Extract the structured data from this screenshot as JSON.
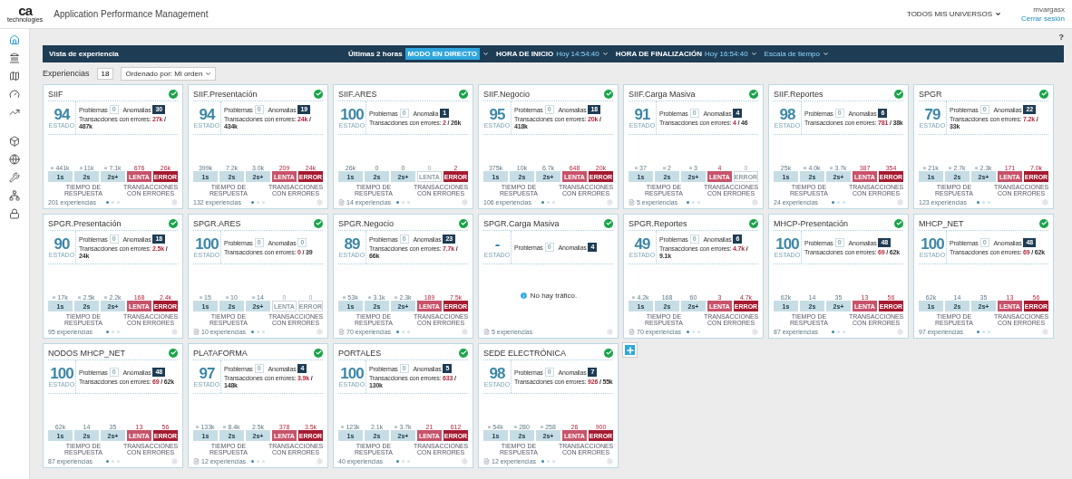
{
  "header": {
    "logo": {
      "mark": "ca",
      "sub": "technologies"
    },
    "title": "Application Performance Management",
    "universe": "TODOS MIS UNIVERSOS",
    "user": "mvargasx",
    "logout": "Cerrar sesión"
  },
  "sidebar": {
    "items": [
      {
        "selected": true
      },
      {
        "selected": false
      },
      {
        "selected": false
      },
      {
        "selected": false
      },
      {
        "selected": false
      },
      {
        "selected": false
      },
      {
        "selected": false
      },
      {
        "selected": false
      },
      {
        "selected": false
      },
      {
        "selected": false
      }
    ]
  },
  "help": "?",
  "toolbar": {
    "title": "Vista de experiencia",
    "range": "Últimas 2 horas",
    "live": "MODO EN DIRECTO",
    "start_label": "HORA DE INICIO",
    "start": "Hoy 14:54:40",
    "end_label": "HORA DE FINALIZACIÓN",
    "end": "Hoy 16:54:40",
    "scale": "Escala de tiempo"
  },
  "summary": {
    "label": "Experiencias",
    "count": "18",
    "sort": "Ordenado por: Mi orden"
  },
  "cards": [
    {
      "title": "SIIF",
      "score": "94",
      "score_label": "ESTADO",
      "problems_label": "Problemas",
      "problems": "0",
      "anomalies_label": "Anomalias",
      "anomalies": "30",
      "anomalies_alert": true,
      "errors_label": "Transacciones con errores:",
      "errors": "27k",
      "total": "/ 487k",
      "bars": [
        {
          "kind": "time",
          "label": "1s",
          "value": "441k",
          "trend": true,
          "muted": false
        },
        {
          "kind": "time",
          "label": "2s",
          "value": "11k",
          "trend": true,
          "muted": false
        },
        {
          "kind": "time",
          "label": "2s+",
          "value": "7.1k",
          "trend": true,
          "muted": false
        },
        {
          "kind": "slow",
          "label": "LENTA",
          "value": "676",
          "trend": false,
          "muted": false
        },
        {
          "kind": "error",
          "label": "ERROR",
          "value": "26k",
          "trend": false,
          "muted": false
        }
      ],
      "axis_left": "TIEMPO DE RESPUESTA",
      "axis_right": "TRANSACCIONES CON ERRORES",
      "footer": "201 experiencias",
      "doc": false,
      "dots": [
        {
          "selected": true
        },
        {
          "selected": false
        },
        {
          "selected": false
        }
      ]
    },
    {
      "title": "SIIF.Presentación",
      "score": "94",
      "score_label": "ESTADO",
      "problems_label": "Problemas",
      "problems": "0",
      "anomalies_label": "Anomalias",
      "anomalies": "19",
      "anomalies_alert": true,
      "errors_label": "Transacciones con errores:",
      "errors": "24k",
      "total": "/ 434k",
      "bars": [
        {
          "kind": "time",
          "label": "1s",
          "value": "399k",
          "trend": false,
          "muted": false
        },
        {
          "kind": "time",
          "label": "2s",
          "value": "7.2k",
          "trend": false,
          "muted": false
        },
        {
          "kind": "time",
          "label": "2s+",
          "value": "3.0k",
          "trend": false,
          "muted": false
        },
        {
          "kind": "slow",
          "label": "LENTA",
          "value": "209",
          "trend": false,
          "muted": false
        },
        {
          "kind": "error",
          "label": "ERROR",
          "value": "24k",
          "trend": false,
          "muted": false
        }
      ],
      "axis_left": "TIEMPO DE RESPUESTA",
      "axis_right": "TRANSACCIONES CON ERRORES",
      "footer": "132 experiencias",
      "doc": false,
      "dots": [
        {
          "selected": true
        },
        {
          "selected": false
        },
        {
          "selected": false
        }
      ]
    },
    {
      "title": "SIIF.ARES",
      "score": "100",
      "score_label": "ESTADO",
      "problems_label": "Problemas",
      "problems": "0",
      "anomalies_label": "Anomalia",
      "anomalies": "1",
      "anomalies_alert": true,
      "errors_label": "Transacciones con errores:",
      "errors": "2",
      "total": "/ 26k",
      "bars": [
        {
          "kind": "time",
          "label": "1s",
          "value": "26k",
          "trend": false,
          "muted": false
        },
        {
          "kind": "time",
          "label": "2s",
          "value": "0",
          "trend": false,
          "muted": false
        },
        {
          "kind": "time",
          "label": "2s+",
          "value": "0",
          "trend": false,
          "muted": false
        },
        {
          "kind": "slow",
          "label": "LENTA",
          "value": "0",
          "trend": false,
          "muted": true
        },
        {
          "kind": "error",
          "label": "ERROR",
          "value": "2",
          "trend": false,
          "muted": false
        }
      ],
      "axis_left": "TIEMPO DE RESPUESTA",
      "axis_right": "TRANSACCIONES CON ERRORES",
      "footer": "14 experiencias",
      "doc": true,
      "dots": [
        {
          "selected": true
        },
        {
          "selected": false
        },
        {
          "selected": false
        }
      ]
    },
    {
      "title": "SIIF.Negocio",
      "score": "95",
      "score_label": "ESTADO",
      "problems_label": "Problemas",
      "problems": "0",
      "anomalies_label": "Anomalias",
      "anomalies": "18",
      "anomalies_alert": true,
      "errors_label": "Transacciones con errores:",
      "errors": "20k",
      "total": "/ 418k",
      "bars": [
        {
          "kind": "time",
          "label": "1s",
          "value": "375k",
          "trend": false,
          "muted": false
        },
        {
          "kind": "time",
          "label": "2s",
          "value": "10k",
          "trend": false,
          "muted": false
        },
        {
          "kind": "time",
          "label": "2s+",
          "value": "6.7k",
          "trend": false,
          "muted": false
        },
        {
          "kind": "slow",
          "label": "LENTA",
          "value": "648",
          "trend": false,
          "muted": false
        },
        {
          "kind": "error",
          "label": "ERROR",
          "value": "20k",
          "trend": false,
          "muted": false
        }
      ],
      "axis_left": "TIEMPO DE RESPUESTA",
      "axis_right": "TRANSACCIONES CON ERRORES",
      "footer": "106 experiencias",
      "doc": false,
      "dots": [
        {
          "selected": true
        },
        {
          "selected": false
        },
        {
          "selected": false
        }
      ]
    },
    {
      "title": "SIIF.Carga Masiva",
      "score": "91",
      "score_label": "ESTADO",
      "problems_label": "Problemas",
      "problems": "0",
      "anomalies_label": "Anomalias",
      "anomalies": "4",
      "anomalies_alert": true,
      "errors_label": "Transacciones con errores:",
      "errors": "4",
      "total": "/ 46",
      "bars": [
        {
          "kind": "time",
          "label": "1s",
          "value": "37",
          "trend": true,
          "muted": false
        },
        {
          "kind": "time",
          "label": "2s",
          "value": "2",
          "trend": true,
          "muted": false
        },
        {
          "kind": "time",
          "label": "2s+",
          "value": "3",
          "trend": true,
          "muted": false
        },
        {
          "kind": "slow",
          "label": "LENTA",
          "value": "4",
          "trend": false,
          "muted": false
        },
        {
          "kind": "error",
          "label": "ERROR",
          "value": "0",
          "trend": false,
          "muted": true
        }
      ],
      "axis_left": "TIEMPO DE RESPUESTA",
      "axis_right": "TRANSACCIONES CON ERRORES",
      "footer": "5 experiencias",
      "doc": true,
      "dots": [
        {
          "selected": true
        },
        {
          "selected": false
        },
        {
          "selected": false
        }
      ]
    },
    {
      "title": "SIIF.Reportes",
      "score": "98",
      "score_label": "ESTADO",
      "problems_label": "Problemas",
      "problems": "0",
      "anomalies_label": "Anomalias",
      "anomalies": "6",
      "anomalies_alert": true,
      "errors_label": "Transacciones con errores:",
      "errors": "781",
      "total": "/ 38k",
      "bars": [
        {
          "kind": "time",
          "label": "1s",
          "value": "25k",
          "trend": false,
          "muted": false
        },
        {
          "kind": "time",
          "label": "2s",
          "value": "4.0k",
          "trend": true,
          "muted": false
        },
        {
          "kind": "time",
          "label": "2s+",
          "value": "3.7k",
          "trend": true,
          "muted": false
        },
        {
          "kind": "slow",
          "label": "LENTA",
          "value": "387",
          "trend": false,
          "muted": false
        },
        {
          "kind": "error",
          "label": "ERROR",
          "value": "354",
          "trend": false,
          "muted": false
        }
      ],
      "axis_left": "TIEMPO DE RESPUESTA",
      "axis_right": "TRANSACCIONES CON ERRORES",
      "footer": "24 experiencias",
      "doc": false,
      "dots": [
        {
          "selected": true
        },
        {
          "selected": false
        },
        {
          "selected": false
        }
      ]
    },
    {
      "title": "SPGR",
      "score": "79",
      "score_label": "ESTADO",
      "problems_label": "Problemas",
      "problems": "0",
      "anomalies_label": "Anomalias",
      "anomalies": "22",
      "anomalies_alert": true,
      "errors_label": "Transacciones con errores:",
      "errors": "7.2k",
      "total": "/ 33k",
      "bars": [
        {
          "kind": "time",
          "label": "1s",
          "value": "21k",
          "trend": true,
          "muted": false
        },
        {
          "kind": "time",
          "label": "2s",
          "value": "2.7k",
          "trend": true,
          "muted": false
        },
        {
          "kind": "time",
          "label": "2s+",
          "value": "2.3k",
          "trend": true,
          "muted": false
        },
        {
          "kind": "slow",
          "label": "LENTA",
          "value": "171",
          "trend": false,
          "muted": false
        },
        {
          "kind": "error",
          "label": "ERROR",
          "value": "7.0k",
          "trend": false,
          "muted": false
        }
      ],
      "axis_left": "TIEMPO DE RESPUESTA",
      "axis_right": "TRANSACCIONES CON ERRORES",
      "footer": "123 experiencias",
      "doc": false,
      "dots": [
        {
          "selected": true
        },
        {
          "selected": false
        },
        {
          "selected": false
        }
      ]
    },
    {
      "title": "SPGR.Presentación",
      "score": "90",
      "score_label": "ESTADO",
      "problems_label": "Problemas",
      "problems": "0",
      "anomalies_label": "Anomalias",
      "anomalies": "18",
      "anomalies_alert": true,
      "errors_label": "Transacciones con errores:",
      "errors": "2.5k",
      "total": "/ 24k",
      "bars": [
        {
          "kind": "time",
          "label": "1s",
          "value": "17k",
          "trend": true,
          "muted": false
        },
        {
          "kind": "time",
          "label": "2s",
          "value": "2.5k",
          "trend": true,
          "muted": false
        },
        {
          "kind": "time",
          "label": "2s+",
          "value": "2.2k",
          "trend": true,
          "muted": false
        },
        {
          "kind": "slow",
          "label": "LENTA",
          "value": "168",
          "trend": false,
          "muted": false
        },
        {
          "kind": "error",
          "label": "ERROR",
          "value": "2.4k",
          "trend": false,
          "muted": false
        }
      ],
      "axis_left": "TIEMPO DE RESPUESTA",
      "axis_right": "TRANSACCIONES CON ERRORES",
      "footer": "95 experiencias",
      "doc": false,
      "dots": [
        {
          "selected": true
        },
        {
          "selected": false
        },
        {
          "selected": false
        }
      ]
    },
    {
      "title": "SPGR.ARES",
      "score": "100",
      "score_label": "ESTADO",
      "problems_label": "Problemas",
      "problems": "0",
      "anomalies_label": "Anomalias",
      "anomalies": "0",
      "anomalies_alert": false,
      "errors_label": "Transacciones con errores:",
      "errors": "0",
      "total": "/ 39",
      "bars": [
        {
          "kind": "time",
          "label": "1s",
          "value": "15",
          "trend": true,
          "muted": false
        },
        {
          "kind": "time",
          "label": "2s",
          "value": "10",
          "trend": true,
          "muted": false
        },
        {
          "kind": "time",
          "label": "2s+",
          "value": "14",
          "trend": true,
          "muted": false
        },
        {
          "kind": "slow",
          "label": "LENTA",
          "value": "0",
          "trend": false,
          "muted": true
        },
        {
          "kind": "error",
          "label": "ERROR",
          "value": "0",
          "trend": false,
          "muted": true
        }
      ],
      "axis_left": "TIEMPO DE RESPUESTA",
      "axis_right": "TRANSACCIONES CON ERRORES",
      "footer": "10 experiencias",
      "doc": true,
      "dots": [
        {
          "selected": true
        },
        {
          "selected": false
        },
        {
          "selected": false
        }
      ]
    },
    {
      "title": "SPGR.Negocio",
      "score": "89",
      "score_label": "ESTADO",
      "problems_label": "Problemas",
      "problems": "0",
      "anomalies_label": "Anomalias",
      "anomalies": "23",
      "anomalies_alert": true,
      "errors_label": "Transacciones con errores:",
      "errors": "7.7k",
      "total": "/ 66k",
      "bars": [
        {
          "kind": "time",
          "label": "1s",
          "value": "53k",
          "trend": true,
          "muted": false
        },
        {
          "kind": "time",
          "label": "2s",
          "value": "3.1k",
          "trend": true,
          "muted": false
        },
        {
          "kind": "time",
          "label": "2s+",
          "value": "2.3k",
          "trend": true,
          "muted": false
        },
        {
          "kind": "slow",
          "label": "LENTA",
          "value": "189",
          "trend": false,
          "muted": false
        },
        {
          "kind": "error",
          "label": "ERROR",
          "value": "7.5k",
          "trend": false,
          "muted": false
        }
      ],
      "axis_left": "TIEMPO DE RESPUESTA",
      "axis_right": "TRANSACCIONES CON ERRORES",
      "footer": "70 experiencias",
      "doc": true,
      "dots": [
        {
          "selected": true
        },
        {
          "selected": false
        },
        {
          "selected": false
        }
      ]
    },
    {
      "title": "SPGR.Carga Masiva",
      "score": "-",
      "score_label": "ESTADO",
      "problems_label": "Problemas",
      "problems": "0",
      "anomalies_label": "Anomalias",
      "anomalies": "4",
      "anomalies_alert": true,
      "no_traffic": "No hay tráfico.",
      "footer": "5 experiencias",
      "doc": true
    },
    {
      "title": "SPGR.Reportes",
      "score": "49",
      "score_label": "ESTADO",
      "problems_label": "Problemas",
      "problems": "0",
      "anomalies_label": "Anomalias",
      "anomalies": "6",
      "anomalies_alert": true,
      "errors_label": "Transacciones con errores:",
      "errors": "4.7k",
      "total": "/ 9.1k",
      "bars": [
        {
          "kind": "time",
          "label": "1s",
          "value": "4.2k",
          "trend": true,
          "muted": false
        },
        {
          "kind": "time",
          "label": "2s",
          "value": "168",
          "trend": false,
          "muted": false
        },
        {
          "kind": "time",
          "label": "2s+",
          "value": "60",
          "trend": false,
          "muted": false
        },
        {
          "kind": "slow",
          "label": "LENTA",
          "value": "3",
          "trend": false,
          "muted": false
        },
        {
          "kind": "error",
          "label": "ERROR",
          "value": "4.7k",
          "trend": false,
          "muted": false
        }
      ],
      "axis_left": "TIEMPO DE RESPUESTA",
      "axis_right": "TRANSACCIONES CON ERRORES",
      "footer": "70 experiencias",
      "doc": true,
      "dots": [
        {
          "selected": true
        },
        {
          "selected": false
        },
        {
          "selected": false
        }
      ]
    },
    {
      "title": "MHCP-Presentación",
      "score": "100",
      "score_label": "ESTADO",
      "problems_label": "Problemas",
      "problems": "0",
      "anomalies_label": "Anomalias",
      "anomalies": "48",
      "anomalies_alert": true,
      "errors_label": "Transacciones con errores:",
      "errors": "69",
      "total": "/ 62k",
      "bars": [
        {
          "kind": "time",
          "label": "1s",
          "value": "62k",
          "trend": false,
          "muted": false
        },
        {
          "kind": "time",
          "label": "2s",
          "value": "14",
          "trend": false,
          "muted": false
        },
        {
          "kind": "time",
          "label": "2s+",
          "value": "35",
          "trend": false,
          "muted": false
        },
        {
          "kind": "slow",
          "label": "LENTA",
          "value": "13",
          "trend": false,
          "muted": false
        },
        {
          "kind": "error",
          "label": "ERROR",
          "value": "56",
          "trend": false,
          "muted": false
        }
      ],
      "axis_left": "TIEMPO DE RESPUESTA",
      "axis_right": "TRANSACCIONES CON ERRORES",
      "footer": "87 experiencias",
      "doc": false,
      "dots": [
        {
          "selected": true
        },
        {
          "selected": false
        },
        {
          "selected": false
        }
      ]
    },
    {
      "title": "MHCP_NET",
      "score": "100",
      "score_label": "ESTADO",
      "problems_label": "Problemas",
      "problems": "0",
      "anomalies_label": "Anomalias",
      "anomalies": "48",
      "anomalies_alert": true,
      "errors_label": "Transacciones con errores:",
      "errors": "69",
      "total": "/ 62k",
      "bars": [
        {
          "kind": "time",
          "label": "1s",
          "value": "62k",
          "trend": false,
          "muted": false
        },
        {
          "kind": "time",
          "label": "2s",
          "value": "14",
          "trend": false,
          "muted": false
        },
        {
          "kind": "time",
          "label": "2s+",
          "value": "35",
          "trend": false,
          "muted": false
        },
        {
          "kind": "slow",
          "label": "LENTA",
          "value": "13",
          "trend": false,
          "muted": false
        },
        {
          "kind": "error",
          "label": "ERROR",
          "value": "56",
          "trend": false,
          "muted": false
        }
      ],
      "axis_left": "TIEMPO DE RESPUESTA",
      "axis_right": "TRANSACCIONES CON ERRORES",
      "footer": "97 experiencias",
      "doc": false,
      "dots": [
        {
          "selected": true
        },
        {
          "selected": false
        },
        {
          "selected": false
        }
      ]
    },
    {
      "title": "NODOS MHCP_NET",
      "score": "100",
      "score_label": "ESTADO",
      "problems_label": "Problemas",
      "problems": "0",
      "anomalies_label": "Anomalias",
      "anomalies": "48",
      "anomalies_alert": true,
      "errors_label": "Transacciones con errores:",
      "errors": "69",
      "total": "/ 62k",
      "bars": [
        {
          "kind": "time",
          "label": "1s",
          "value": "62k",
          "trend": false,
          "muted": false
        },
        {
          "kind": "time",
          "label": "2s",
          "value": "14",
          "trend": false,
          "muted": false
        },
        {
          "kind": "time",
          "label": "2s+",
          "value": "35",
          "trend": false,
          "muted": false
        },
        {
          "kind": "slow",
          "label": "LENTA",
          "value": "13",
          "trend": false,
          "muted": false
        },
        {
          "kind": "error",
          "label": "ERROR",
          "value": "56",
          "trend": false,
          "muted": false
        }
      ],
      "axis_left": "TIEMPO DE RESPUESTA",
      "axis_right": "TRANSACCIONES CON ERRORES",
      "footer": "87 experiencias",
      "doc": false,
      "dots": [
        {
          "selected": true
        },
        {
          "selected": false
        },
        {
          "selected": false
        }
      ]
    },
    {
      "title": "PLATAFORMA",
      "score": "97",
      "score_label": "ESTADO",
      "problems_label": "Problemas",
      "problems": "0",
      "anomalies_label": "Anomalias",
      "anomalies": "4",
      "anomalies_alert": true,
      "errors_label": "Transacciones con errores:",
      "errors": "3.9k",
      "total": "/ 148k",
      "bars": [
        {
          "kind": "time",
          "label": "1s",
          "value": "133k",
          "trend": true,
          "muted": false
        },
        {
          "kind": "time",
          "label": "2s",
          "value": "8.4k",
          "trend": true,
          "muted": false
        },
        {
          "kind": "time",
          "label": "2s+",
          "value": "2.5k",
          "trend": false,
          "muted": false
        },
        {
          "kind": "slow",
          "label": "LENTA",
          "value": "378",
          "trend": false,
          "muted": false
        },
        {
          "kind": "error",
          "label": "ERROR",
          "value": "3.5k",
          "trend": false,
          "muted": false
        }
      ],
      "axis_left": "TIEMPO DE RESPUESTA",
      "axis_right": "TRANSACCIONES CON ERRORES",
      "footer": "12 experiencias",
      "doc": true,
      "dots": [
        {
          "selected": true
        },
        {
          "selected": false
        },
        {
          "selected": false
        }
      ]
    },
    {
      "title": "PORTALES",
      "score": "100",
      "score_label": "ESTADO",
      "problems_label": "Problemas",
      "problems": "0",
      "anomalies_label": "Anomalias",
      "anomalies": "5",
      "anomalies_alert": true,
      "errors_label": "Transacciones con errores:",
      "errors": "633",
      "total": "/ 130k",
      "bars": [
        {
          "kind": "time",
          "label": "1s",
          "value": "123k",
          "trend": true,
          "muted": false
        },
        {
          "kind": "time",
          "label": "2s",
          "value": "2.1k",
          "trend": false,
          "muted": false
        },
        {
          "kind": "time",
          "label": "2s+",
          "value": "3.7k",
          "trend": true,
          "muted": false
        },
        {
          "kind": "slow",
          "label": "LENTA",
          "value": "21",
          "trend": false,
          "muted": false
        },
        {
          "kind": "error",
          "label": "ERROR",
          "value": "612",
          "trend": false,
          "muted": false
        }
      ],
      "axis_left": "TIEMPO DE RESPUESTA",
      "axis_right": "TRANSACCIONES CON ERRORES",
      "footer": "40 experiencias",
      "doc": false,
      "dots": [
        {
          "selected": true
        },
        {
          "selected": false
        },
        {
          "selected": false
        }
      ]
    },
    {
      "title": "SEDE ELECTRÓNICA",
      "score": "98",
      "score_label": "ESTADO",
      "problems_label": "Problemas",
      "problems": "0",
      "anomalies_label": "Anomalias",
      "anomalies": "7",
      "anomalies_alert": true,
      "errors_label": "Transacciones con errores:",
      "errors": "926",
      "total": "/ 55k",
      "bars": [
        {
          "kind": "time",
          "label": "1s",
          "value": "54k",
          "trend": true,
          "muted": false
        },
        {
          "kind": "time",
          "label": "2s",
          "value": "280",
          "trend": true,
          "muted": false
        },
        {
          "kind": "time",
          "label": "2s+",
          "value": "258",
          "trend": true,
          "muted": false
        },
        {
          "kind": "slow",
          "label": "LENTA",
          "value": "26",
          "trend": false,
          "muted": false
        },
        {
          "kind": "error",
          "label": "ERROR",
          "value": "900",
          "trend": false,
          "muted": false
        }
      ],
      "axis_left": "TIEMPO DE RESPUESTA",
      "axis_right": "TRANSACCIONES CON ERRORES",
      "footer": "12 experiencias",
      "doc": true,
      "dots": [
        {
          "selected": true
        },
        {
          "selected": false
        },
        {
          "selected": false
        }
      ]
    }
  ]
}
